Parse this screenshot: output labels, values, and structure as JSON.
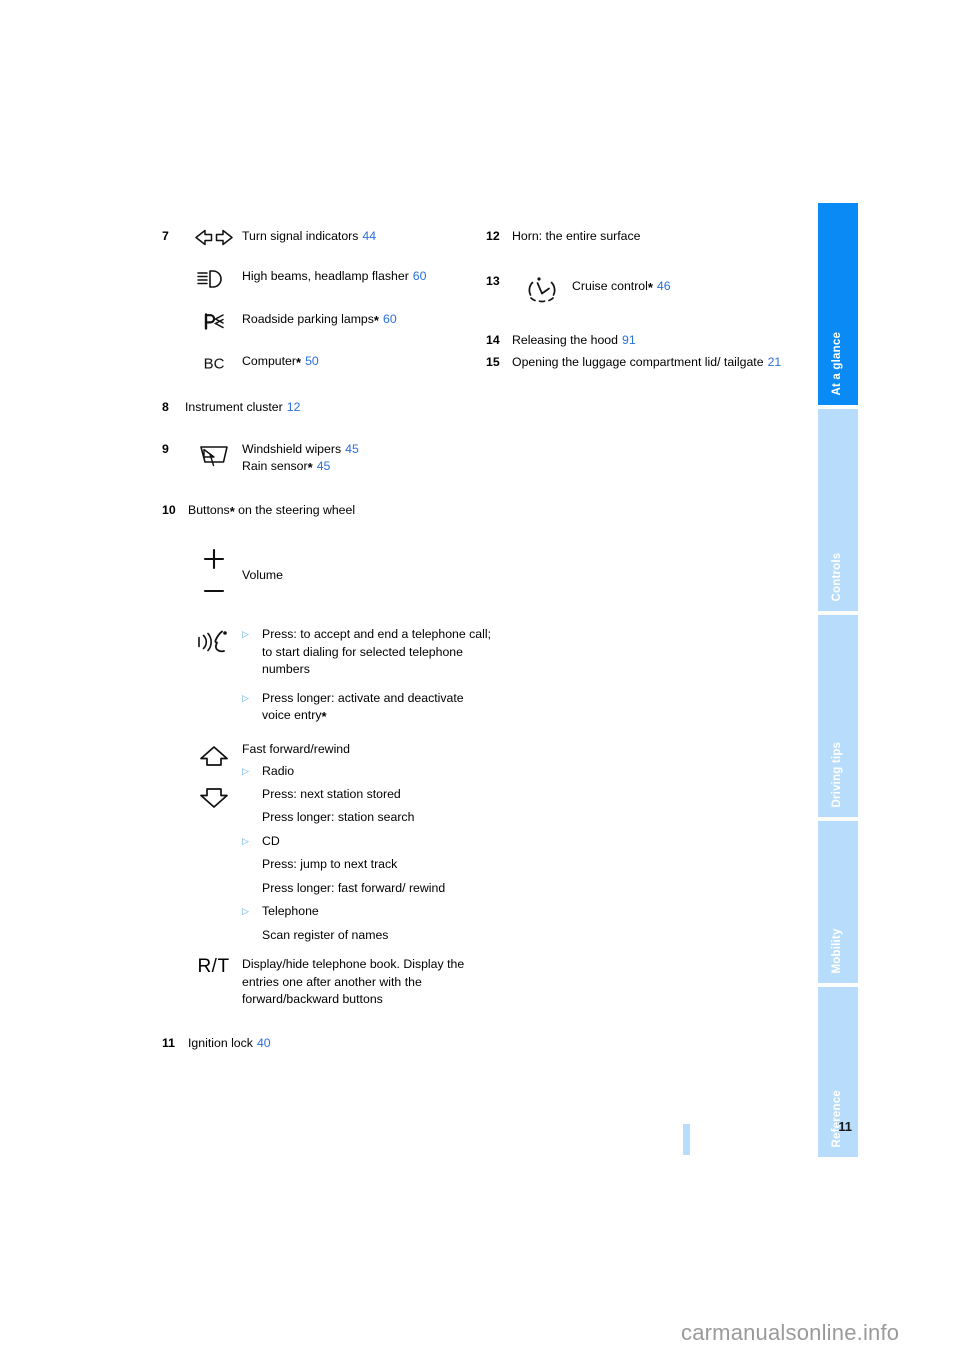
{
  "document": {
    "page_number": "11",
    "watermark": "carmanualsonline.info"
  },
  "tabs": [
    {
      "label": "At a glance",
      "active": true
    },
    {
      "label": "Controls",
      "active": false
    },
    {
      "label": "Driving tips",
      "active": false
    },
    {
      "label": "Mobility",
      "active": false
    },
    {
      "label": "Reference",
      "active": false
    }
  ],
  "colors": {
    "tab_active": "#0a8af5",
    "tab_inactive": "#b8dcfb",
    "page_ref": "#2a6fdb",
    "bullet": "#5aade8"
  },
  "left_column": {
    "item7": {
      "num": "7",
      "rows": [
        {
          "icon": "turn-signal-indicators-icon",
          "label": "Turn signal indicators",
          "page": "44",
          "optional": false
        },
        {
          "icon": "high-beams-headlamp-flasher-icon",
          "label": "High beams, headlamp flasher",
          "page": "60",
          "optional": false
        },
        {
          "icon": "roadside-parking-lamps-icon",
          "label": "Roadside parking lamps",
          "page": "60",
          "optional": true
        },
        {
          "icon": "onboard-computer-icon",
          "label": "Computer",
          "page": "50",
          "optional": true
        }
      ]
    },
    "item8": {
      "num": "8",
      "label": "Instrument cluster",
      "page": "12"
    },
    "item9": {
      "num": "9",
      "icon": "windshield-wiper-icon",
      "lines": [
        {
          "label": "Windshield wipers",
          "page": "45",
          "optional": false
        },
        {
          "label": "Rain sensor",
          "page": "45",
          "optional": true
        }
      ]
    },
    "item10": {
      "num": "10",
      "heading_pre": "Buttons",
      "heading_post": " on the steering wheel",
      "heading_optional": true,
      "volume": {
        "icon_plus": "volume-up-icon",
        "icon_minus": "volume-down-icon",
        "label": "Volume"
      },
      "telephone": {
        "icon": "voice-telephone-icon",
        "bullets": [
          "Press: to accept and end a telephone call; to start dialing for selected telephone numbers",
          "Press longer: activate and deactivate voice entry"
        ],
        "bullet2_optional": true
      },
      "forward_rewind": {
        "icon_up": "arrow-up-icon",
        "icon_down": "arrow-down-icon",
        "heading": "Fast forward/rewind",
        "groups": [
          {
            "bullet": "Radio",
            "lines": [
              "Press: next station stored",
              "Press longer: station search"
            ]
          },
          {
            "bullet": "CD",
            "lines": [
              "Press: jump to next track",
              "Press longer: fast forward/ rewind"
            ]
          },
          {
            "bullet": "Telephone",
            "lines": [
              "Scan register of names"
            ]
          }
        ]
      },
      "rt": {
        "icon": "rt-button-icon",
        "icon_text": "R/T",
        "label": "Display/hide telephone book. Display the entries one after another with the forward/backward buttons"
      }
    },
    "item11": {
      "num": "11",
      "label": "Ignition lock",
      "page": "40"
    }
  },
  "right_column": {
    "item12": {
      "num": "12",
      "label": "Horn: the entire surface"
    },
    "item13": {
      "num": "13",
      "icon": "cruise-control-icon",
      "label": "Cruise control",
      "page": "46",
      "optional": true
    },
    "item14": {
      "num": "14",
      "label": "Releasing the hood",
      "page": "91"
    },
    "item15": {
      "num": "15",
      "label": "Opening the luggage compartment lid/ tailgate",
      "page": "21"
    }
  }
}
